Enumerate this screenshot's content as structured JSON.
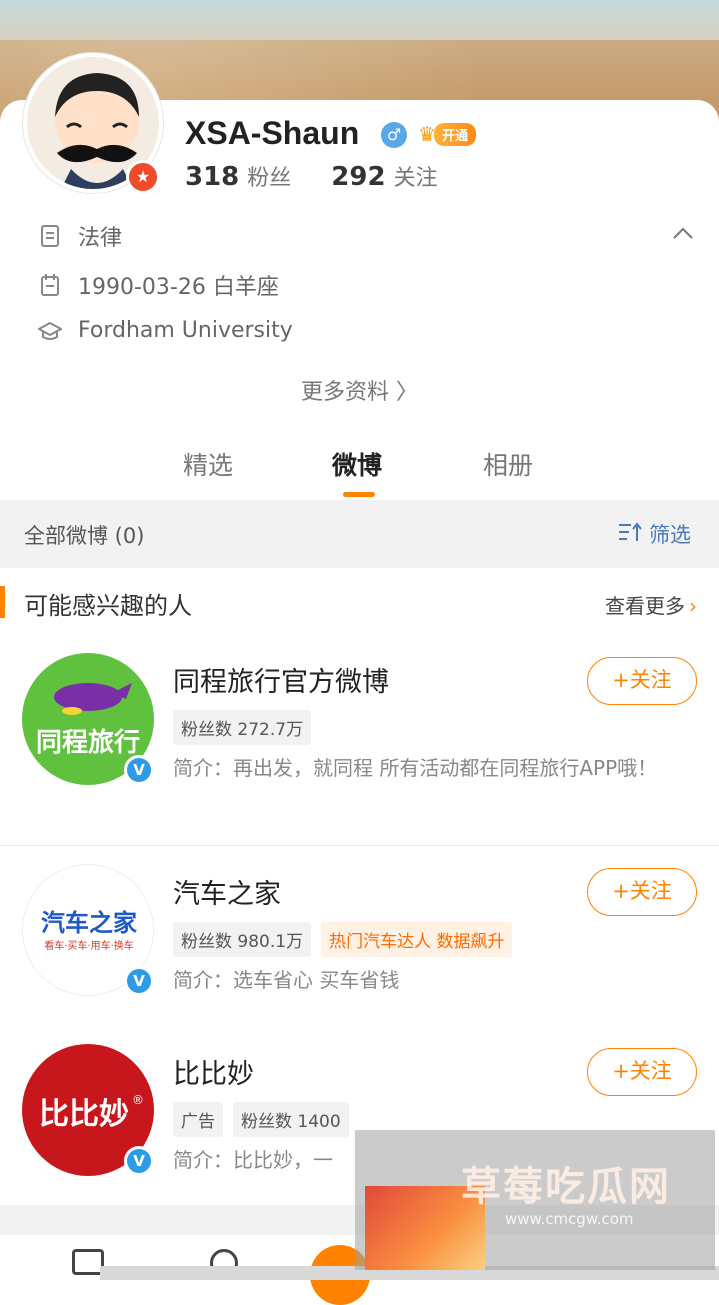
{
  "profile": {
    "username": "XSA-Shaun",
    "gender_symbol": "♂",
    "vip_label": "开通",
    "followers_count": "318",
    "followers_label": "粉丝",
    "following_count": "292",
    "following_label": "关注",
    "occupation": "法律",
    "birthday": "1990-03-26 白羊座",
    "school": "Fordham University",
    "more_info": "更多资料 〉"
  },
  "tabs": [
    {
      "label": "精选"
    },
    {
      "label": "微博"
    },
    {
      "label": "相册"
    }
  ],
  "filter_bar": {
    "all_posts": "全部微博 (0)",
    "filter_label": "筛选"
  },
  "suggestions": {
    "title": "可能感兴趣的人",
    "see_more": "查看更多",
    "follow_label": "+关注",
    "people": [
      {
        "name": "同程旅行官方微博",
        "logo_text": "同程旅行",
        "tags": [
          "粉丝数 272.7万"
        ],
        "desc": "简介：再出发，就同程 所有活动都在同程旅行APP哦！"
      },
      {
        "name": "汽车之家",
        "logo_text": "汽车之家",
        "logo_sub": "看车·买车·用车·换车",
        "tags": [
          "粉丝数 980.1万"
        ],
        "hot_tag": "热门汽车达人 数据飙升",
        "desc": "简介：选车省心 买车省钱"
      },
      {
        "name": "比比妙",
        "logo_text": "比比妙",
        "logo_mark": "®",
        "tags": [
          "广告",
          "粉丝数 1400"
        ],
        "desc": "简介：比比妙，一"
      }
    ]
  },
  "watermark": {
    "title": "草莓吃瓜网",
    "url": "www.cmcgw.com"
  },
  "colors": {
    "accent": "#ff8200",
    "filter_blue": "#4a7ab8",
    "verified_blue": "#2e9be6"
  }
}
